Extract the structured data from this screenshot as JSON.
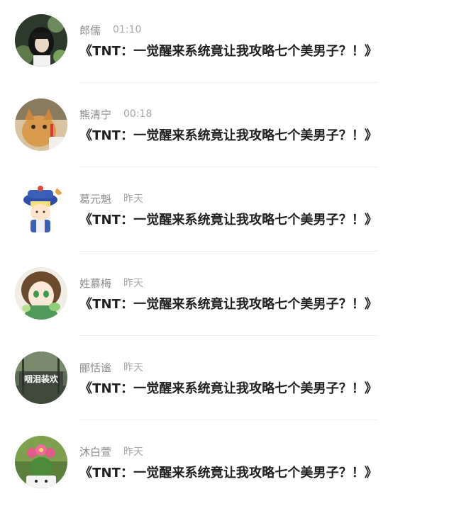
{
  "messages": [
    {
      "name": "郎儒",
      "time": "01:10",
      "text": "《TNT：一觉醒来系统竟让我攻略七个美男子？！》",
      "avatar": "girl-with-camera-avatar"
    },
    {
      "name": "熊清宁",
      "time": "00:18",
      "text": "《TNT：一觉醒来系统竟让我攻略七个美男子？！》",
      "avatar": "cat-avatar"
    },
    {
      "name": "葛元魁",
      "time": "昨天",
      "text": "《TNT：一觉醒来系统竟让我攻略七个美男子？！》",
      "avatar": "cartoon-qing-official-avatar"
    },
    {
      "name": "姓慕梅",
      "time": "昨天",
      "text": "《TNT：一觉醒来系统竟让我攻略七个美男子？！》",
      "avatar": "anime-girl-avatar"
    },
    {
      "name": "郦恬谧",
      "time": "昨天",
      "text": "《TNT：一觉醒来系统竟让我攻略七个美男子？！》",
      "avatar": "text-badge-avatar",
      "avatar_text": "咽泪装欢"
    },
    {
      "name": "沐白萱",
      "time": "昨天",
      "text": "《TNT：一觉醒来系统竟让我攻略七个美男子？！》",
      "avatar": "cactus-flower-avatar"
    }
  ]
}
